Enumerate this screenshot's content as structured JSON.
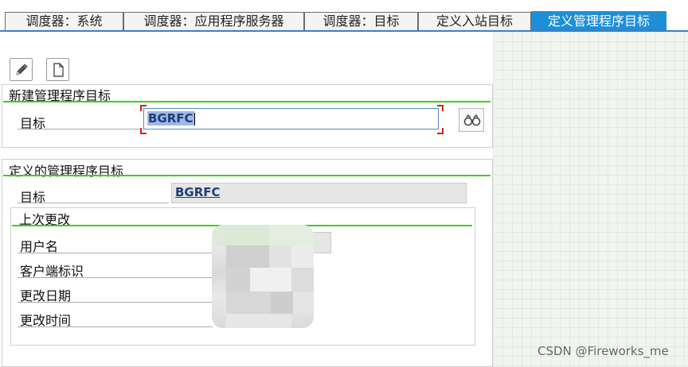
{
  "tabs": [
    {
      "label": "调度器：系统"
    },
    {
      "label": "调度器：应用程序服务器"
    },
    {
      "label": "调度器：目标"
    },
    {
      "label": "定义入站目标"
    },
    {
      "label": "定义管理程序目标",
      "active": true
    }
  ],
  "toolbar": {
    "edit_icon": "pencil-icon",
    "new_icon": "document-icon"
  },
  "new_section": {
    "title": "新建管理程序目标",
    "target_label": "目标",
    "target_value": "BGRFC",
    "search_icon": "binoculars-icon"
  },
  "defined_section": {
    "title": "定义的管理程序目标",
    "target_label": "目标",
    "target_value": "BGRFC",
    "last_change": {
      "title": "上次更改",
      "fields": [
        {
          "label": "用户名"
        },
        {
          "label": "客户端标识"
        },
        {
          "label": "更改日期"
        },
        {
          "label": "更改时间"
        }
      ]
    }
  },
  "watermark": "CSDN @Fireworks_me",
  "colors": {
    "active_tab": "#1d8fd6",
    "section_underline": "#3ad11a",
    "focus_corner": "#d32020"
  }
}
